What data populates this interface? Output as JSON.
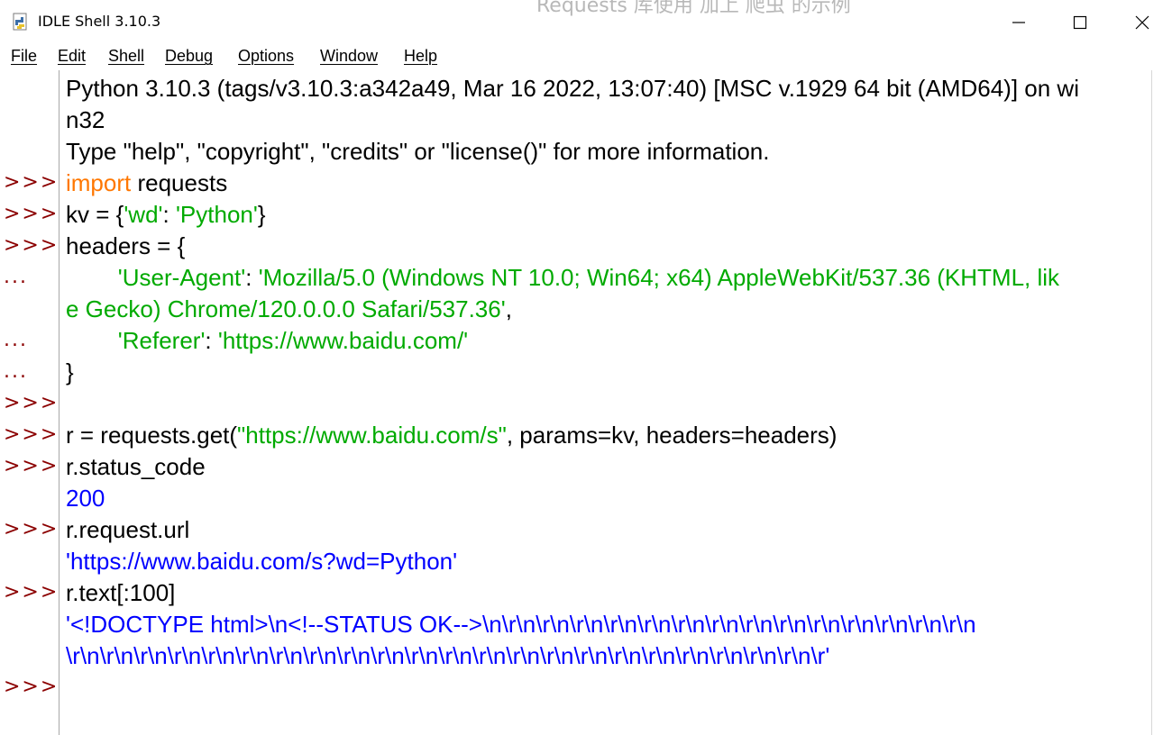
{
  "window": {
    "title": "IDLE Shell 3.10.3",
    "background_title": "Requests 库使用 加上 爬虫 的示例"
  },
  "menu": [
    "File",
    "Edit",
    "Shell",
    "Debug",
    "Options",
    "Window",
    "Help"
  ],
  "colors": {
    "keyword": "#ff7700",
    "string": "#00aa00",
    "output": "#0000ff",
    "prompt": "#8b0000",
    "text": "#000000"
  },
  "icons": {
    "app": "python-idle-icon",
    "minimize": "minimize-icon",
    "maximize": "maximize-icon",
    "close": "close-icon"
  },
  "gutter": [
    {
      "row": 3,
      "text": ">>>"
    },
    {
      "row": 4,
      "text": ">>>"
    },
    {
      "row": 5,
      "text": ">>>"
    },
    {
      "row": 6,
      "text": "..."
    },
    {
      "row": 8,
      "text": "..."
    },
    {
      "row": 9,
      "text": "..."
    },
    {
      "row": 10,
      "text": ">>>"
    },
    {
      "row": 11,
      "text": ">>>"
    },
    {
      "row": 12,
      "text": ">>>"
    },
    {
      "row": 14,
      "text": ">>>"
    },
    {
      "row": 16,
      "text": ">>>"
    },
    {
      "row": 19,
      "text": ">>>"
    }
  ],
  "lines": [
    [
      {
        "t": "Python 3.10.3 (tags/v3.10.3:a342a49, Mar 16 2022, 13:07:40) [MSC v.1929 64 bit (AMD64)] on wi",
        "c": "text"
      }
    ],
    [
      {
        "t": "n32",
        "c": "text"
      }
    ],
    [
      {
        "t": "Type \"help\", \"copyright\", \"credits\" or \"license()\" for more information.",
        "c": "text"
      }
    ],
    [
      {
        "t": "import",
        "c": "keyword"
      },
      {
        "t": " requests",
        "c": "text"
      }
    ],
    [
      {
        "t": "kv = {",
        "c": "text"
      },
      {
        "t": "'wd'",
        "c": "string"
      },
      {
        "t": ": ",
        "c": "text"
      },
      {
        "t": "'Python'",
        "c": "string"
      },
      {
        "t": "}",
        "c": "text"
      }
    ],
    [
      {
        "t": "headers = {",
        "c": "text"
      }
    ],
    [
      {
        "t": "        ",
        "c": "text"
      },
      {
        "t": "'User-Agent'",
        "c": "string"
      },
      {
        "t": ": ",
        "c": "text"
      },
      {
        "t": "'Mozilla/5.0 (Windows NT 10.0; Win64; x64) AppleWebKit/537.36 (KHTML, lik",
        "c": "string"
      }
    ],
    [
      {
        "t": "e Gecko) Chrome/120.0.0.0 Safari/537.36'",
        "c": "string"
      },
      {
        "t": ",",
        "c": "text"
      }
    ],
    [
      {
        "t": "        ",
        "c": "text"
      },
      {
        "t": "'Referer'",
        "c": "string"
      },
      {
        "t": ": ",
        "c": "text"
      },
      {
        "t": "'https://www.baidu.com/'",
        "c": "string"
      }
    ],
    [
      {
        "t": "}",
        "c": "text"
      }
    ],
    [],
    [
      {
        "t": "r = requests.get(",
        "c": "text"
      },
      {
        "t": "\"https://www.baidu.com/s\"",
        "c": "string"
      },
      {
        "t": ", params=kv, headers=headers)",
        "c": "text"
      }
    ],
    [
      {
        "t": "r.status_code",
        "c": "text"
      }
    ],
    [
      {
        "t": "200",
        "c": "output"
      }
    ],
    [
      {
        "t": "r.request.url",
        "c": "text"
      }
    ],
    [
      {
        "t": "'https://www.baidu.com/s?wd=Python'",
        "c": "output"
      }
    ],
    [
      {
        "t": "r.text[:100]",
        "c": "text"
      }
    ],
    [
      {
        "t": "'<!DOCTYPE html>\\n<!--STATUS OK-->\\n\\r\\n\\r\\n\\r\\n\\r\\n\\r\\n\\r\\n\\r\\n\\r\\n\\r\\n\\r\\n\\r\\n\\r\\n\\r\\n\\r\\n",
        "c": "output"
      }
    ],
    [
      {
        "t": "\\r\\n\\r\\n\\r\\n\\r\\n\\r\\n\\r\\n\\r\\n\\r\\n\\r\\n\\r\\n\\r\\n\\r\\n\\r\\n\\r\\n\\r\\n\\r\\n\\r\\n\\r\\n\\r\\n\\r\\n\\r\\n\\r\\n\\r'",
        "c": "output"
      }
    ],
    []
  ]
}
